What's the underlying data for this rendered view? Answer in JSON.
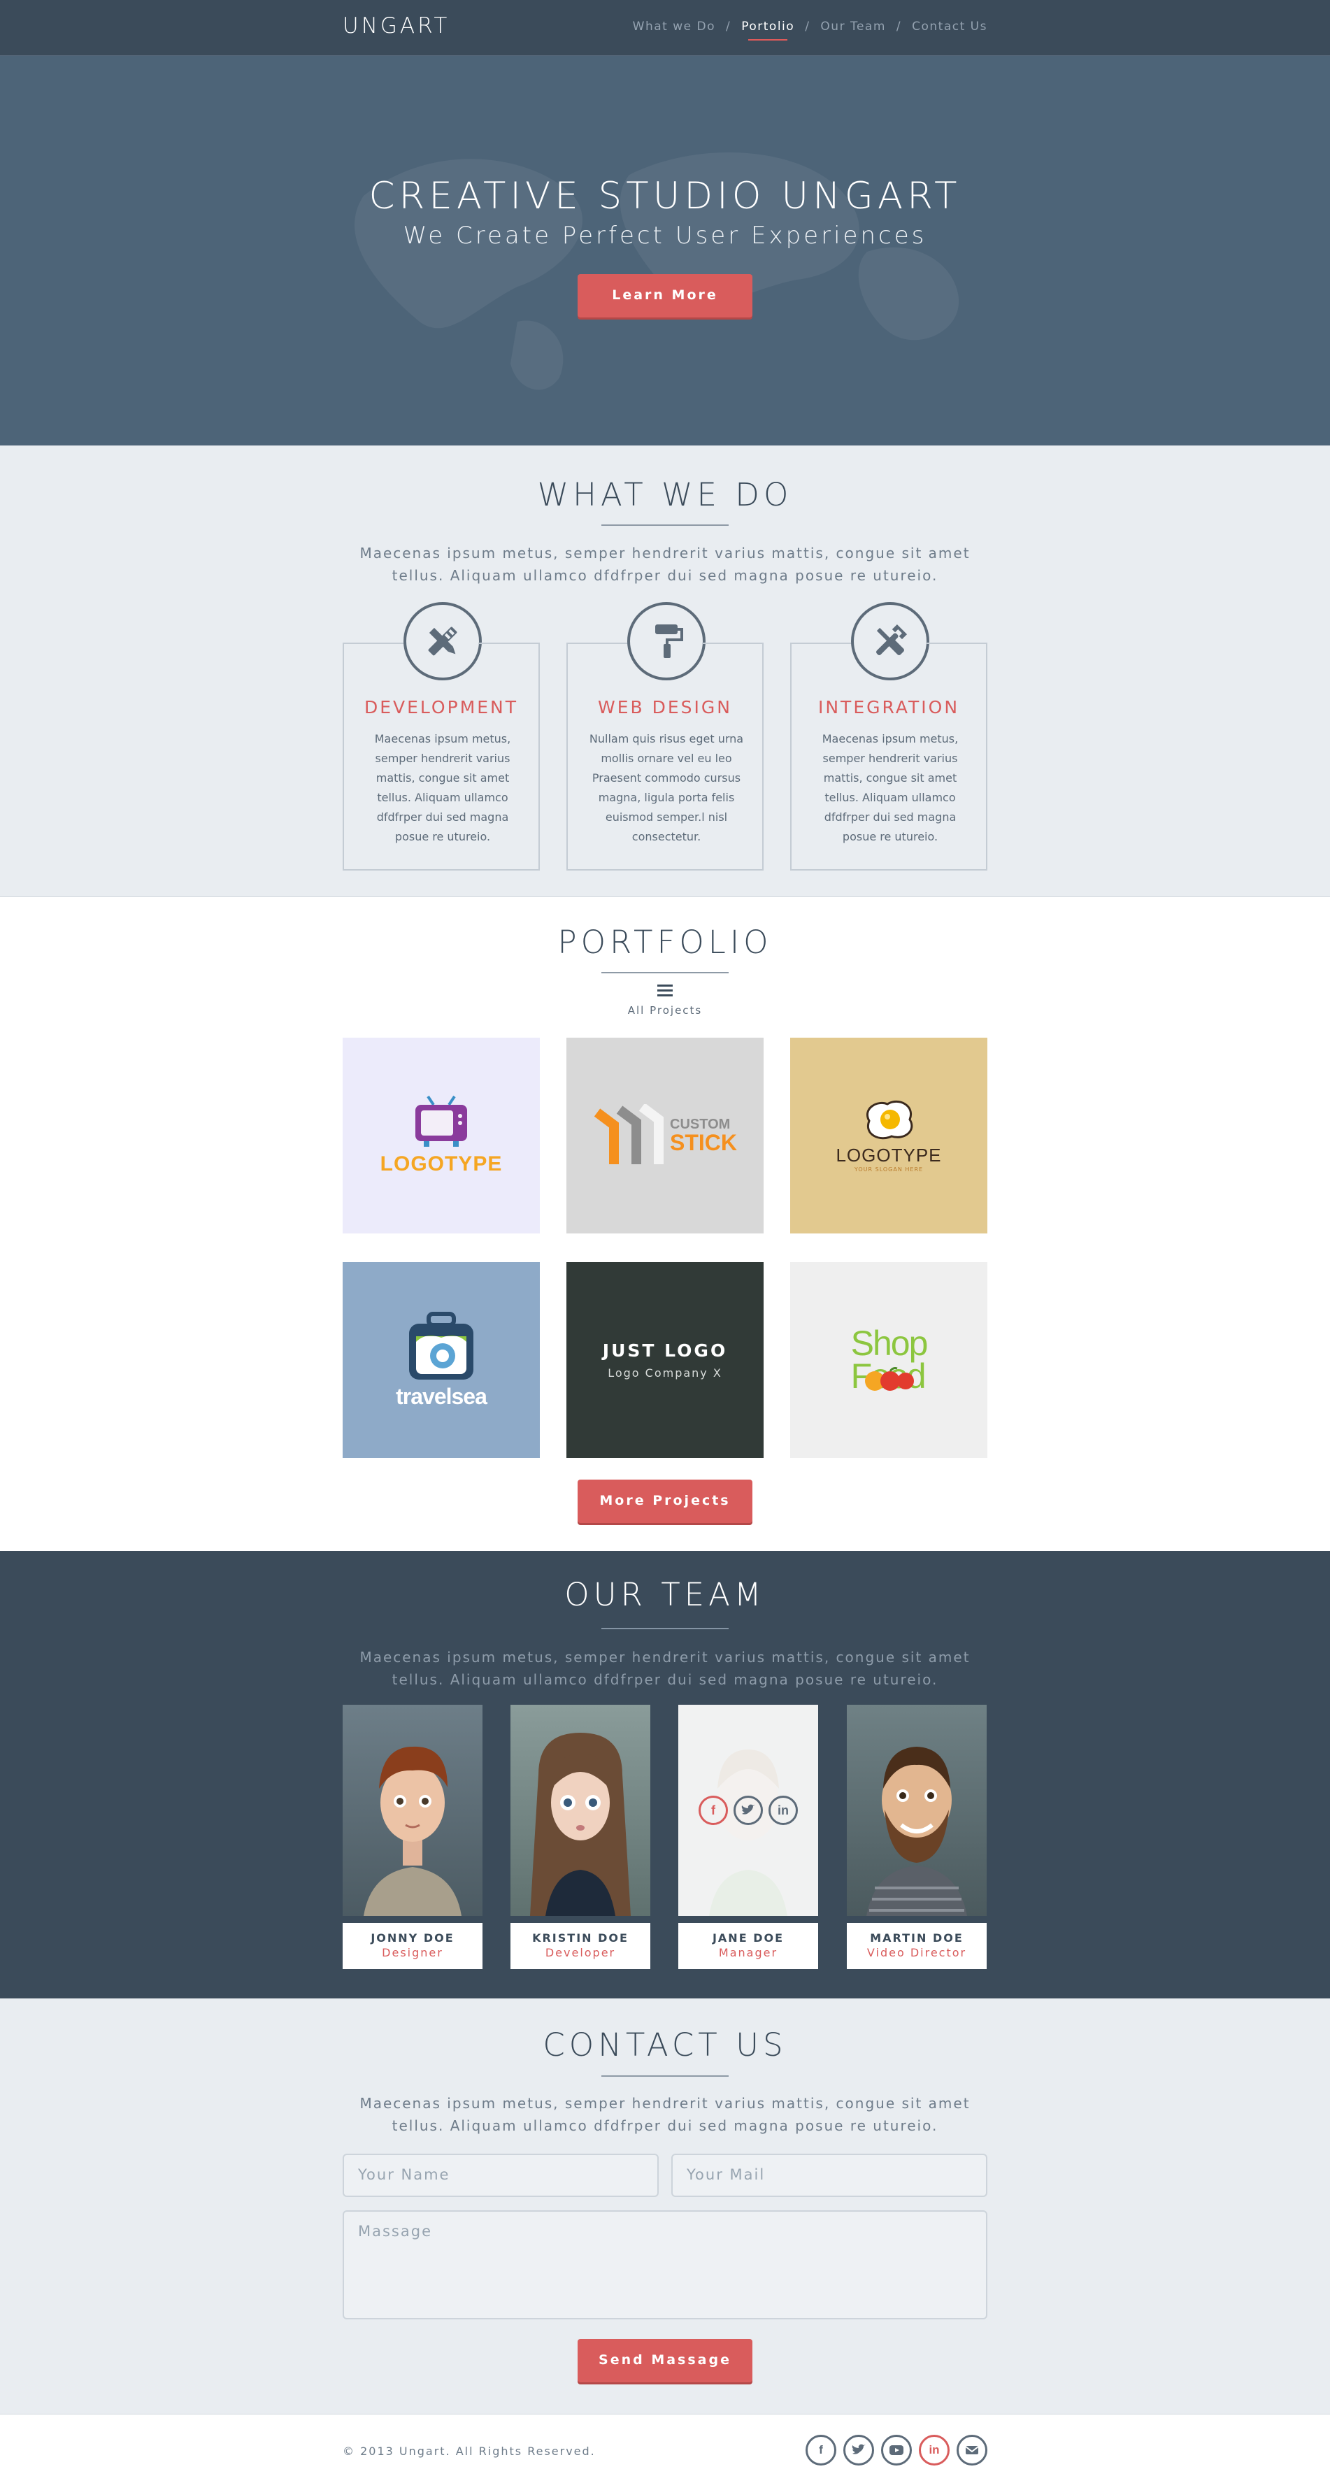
{
  "header": {
    "logo": "UNGART",
    "nav": [
      "What we Do",
      "Portolio",
      "Our Team",
      "Contact Us"
    ],
    "active": "Portolio"
  },
  "hero": {
    "title": "CREATIVE STUDIO UNGART",
    "subtitle": "We Create Perfect User Experiences",
    "button": "Learn More"
  },
  "whatwedo": {
    "title": "WHAT WE DO",
    "text": "Maecenas ipsum metus, semper hendrerit varius mattis, congue sit amet tellus. Aliquam ullamco dfdfrper dui sed magna posue re utureio.",
    "services": [
      {
        "title": "DEVELOPMENT",
        "icon": "pencil-ruler-icon",
        "text": "Maecenas ipsum metus, semper hendrerit varius mattis, congue sit amet tellus. Aliquam ullamco dfdfrper dui sed magna posue re utureio."
      },
      {
        "title": "WEB DESIGN",
        "icon": "paint-roller-icon",
        "text": "Nullam quis risus eget urna mollis ornare vel eu leo Praesent commodo cursus magna, ligula porta felis euismod semper.l nisl consectetur."
      },
      {
        "title": "INTEGRATION",
        "icon": "tools-icon",
        "text": "Maecenas ipsum metus, semper hendrerit varius mattis, congue sit amet tellus. Aliquam ullamco dfdfrper dui sed magna posue re utureio."
      }
    ]
  },
  "portfolio": {
    "title": "PORTFOLIO",
    "filter_label": "All Projects",
    "items": [
      {
        "logo": "LOGOTYPE",
        "bg": "#ecebfb"
      },
      {
        "logo": "CUSTOM",
        "logo2": "STICK",
        "bg": "#d8d8d8"
      },
      {
        "logo": "LOGOTYPE",
        "tagline": "YOUR SLOGAN HERE",
        "bg": "#e2c98f"
      },
      {
        "logo": "travelsea",
        "bg": "#8eaac8"
      },
      {
        "logo": "JUST LOGO",
        "tagline": "Logo Company X",
        "bg": "#313a37"
      },
      {
        "logo": "Shop",
        "logo2": "Food",
        "bg": "#efefef"
      }
    ],
    "button": "More Projects"
  },
  "team": {
    "title": "OUR TEAM",
    "text": "Maecenas ipsum metus, semper hendrerit varius mattis, congue sit amet tellus. Aliquam ullamco dfdfrper dui sed magna posue re utureio.",
    "members": [
      {
        "name": "JONNY DOE",
        "role": "Designer"
      },
      {
        "name": "KRISTIN DOE",
        "role": "Developer"
      },
      {
        "name": "JANE DOE",
        "role": "Manager"
      },
      {
        "name": "MARTIN DOE",
        "role": "Video Director"
      }
    ]
  },
  "contact": {
    "title": "CONTACT US",
    "text": "Maecenas ipsum metus, semper hendrerit varius mattis, congue sit amet tellus. Aliquam ullamco dfdfrper dui sed magna posue re utureio.",
    "name_placeholder": "Your Name",
    "mail_placeholder": "Your Mail",
    "message_placeholder": "Massage",
    "button": "Send Massage"
  },
  "footer": {
    "copyright": "© 2013 Ungart. All Rights Reserved."
  },
  "colors": {
    "accent": "#d95c5c",
    "dark": "#3b4b5a",
    "hero": "#4d6478"
  }
}
